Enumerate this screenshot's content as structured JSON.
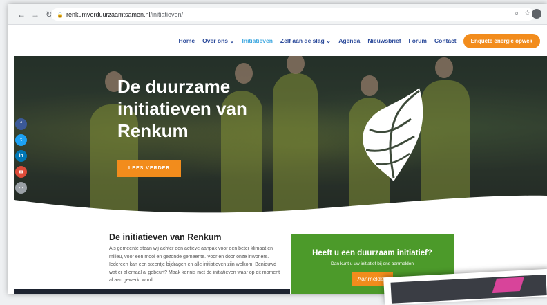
{
  "browser": {
    "url_host": "renkumverduurzaamtsamen.nl",
    "url_path": "/initiatieven/"
  },
  "nav": {
    "items": [
      {
        "label": "Home"
      },
      {
        "label": "Over ons ⌄"
      },
      {
        "label": "Initiatieven"
      },
      {
        "label": "Zelf aan de slag ⌄"
      },
      {
        "label": "Agenda"
      },
      {
        "label": "Nieuwsbrief"
      },
      {
        "label": "Forum"
      },
      {
        "label": "Contact"
      }
    ],
    "active_index": 2,
    "cta": "Enquête energie opwek"
  },
  "hero": {
    "title": "De duurzame initiatieven van Renkum",
    "button": "LEES VERDER"
  },
  "social": {
    "items": [
      "f",
      "t",
      "in",
      "✉",
      "⋯"
    ]
  },
  "content": {
    "title": "De initiatieven van Renkum",
    "text": "Als gemeente staan wij achter een actieve aanpak voor een beter klimaat en milieu, voor een mooi en gezonde gemeente. Voor en door onze inwoners. Iedereen kan een steentje bijdragen en alle initiatieven zijn welkom! Benieuwd wat er allemaal al gebeurt? Maak kennis met de initiatieven waar op dit moment al aan gewerkt wordt."
  },
  "callout": {
    "title": "Heeft u een duurzaam initiatief?",
    "subtitle": "Dan kunt u uw initiatief bij ons aanmelden",
    "button": "Aanmelden"
  },
  "colors": {
    "accent_orange": "#f28c1c",
    "nav_blue": "#2b4a9a",
    "active_blue": "#3fa8e0",
    "callout_green": "#4c9a2a"
  }
}
